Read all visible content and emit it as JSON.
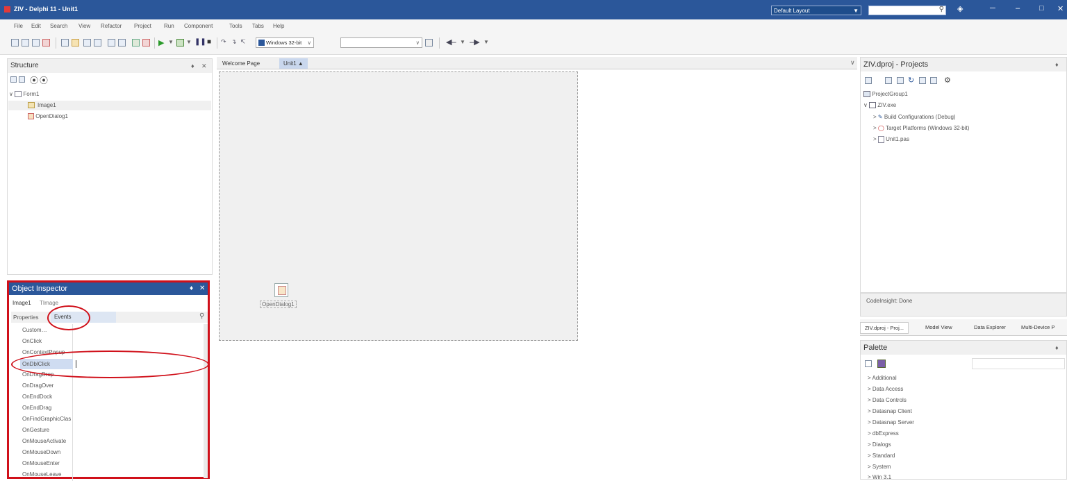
{
  "window": {
    "title": "ZIV - Delphi 11 - Unit1",
    "layout_selector": "Default Layout",
    "search_icon": "search-icon",
    "controls": [
      "help-icon",
      "minimize-icon",
      "maximize-icon",
      "close-icon"
    ]
  },
  "menu": [
    "File",
    "Edit",
    "Search",
    "View",
    "Refactor",
    "Project",
    "Run",
    "Component",
    "Tools",
    "Tabs",
    "Help"
  ],
  "toolbar": {
    "platform": "Windows 32-bit",
    "config": ""
  },
  "structure": {
    "title": "Structure",
    "tree": [
      "Form1",
      "Image1",
      "OpenDialog1"
    ]
  },
  "object_inspector": {
    "title": "Object Inspector",
    "object": "Image1",
    "object_type": "TImage",
    "tabs": [
      "Properties",
      "Events"
    ],
    "active_tab": "Events",
    "events": [
      "Custom…",
      "OnClick",
      "OnContextPopup",
      "OnDblClick",
      "OnDragDrop",
      "OnDragOver",
      "OnEndDock",
      "OnEndDrag",
      "OnFindGraphicClass",
      "OnGesture",
      "OnMouseActivate",
      "OnMouseDown",
      "OnMouseEnter",
      "OnMouseLeave"
    ],
    "selected_event": "OnDblClick"
  },
  "designer": {
    "tabs": [
      "Welcome Page",
      "Unit1"
    ],
    "active_tab": "Unit1",
    "component_label": "OpenDialog1"
  },
  "projects": {
    "title": "ZIV.dproj - Projects",
    "tree": [
      "ProjectGroup1",
      "ZIV.exe",
      "Build Configurations (Debug)",
      "Target Platforms (Windows 32-bit)",
      "Unit1.pas"
    ],
    "codeinsight": "CodeInsight: Done",
    "tabs": [
      "ZIV.dproj - Proj...",
      "Model View",
      "Data Explorer",
      "Multi-Device P"
    ]
  },
  "palette": {
    "title": "Palette",
    "items": [
      "Additional",
      "Data Access",
      "Data Controls",
      "Datasnap Client",
      "Datasnap Server",
      "dbExpress",
      "Dialogs",
      "Standard",
      "System",
      "Win 3.1"
    ]
  },
  "colors": {
    "title_bar": "#2b579a",
    "annotation": "#d0101a"
  }
}
